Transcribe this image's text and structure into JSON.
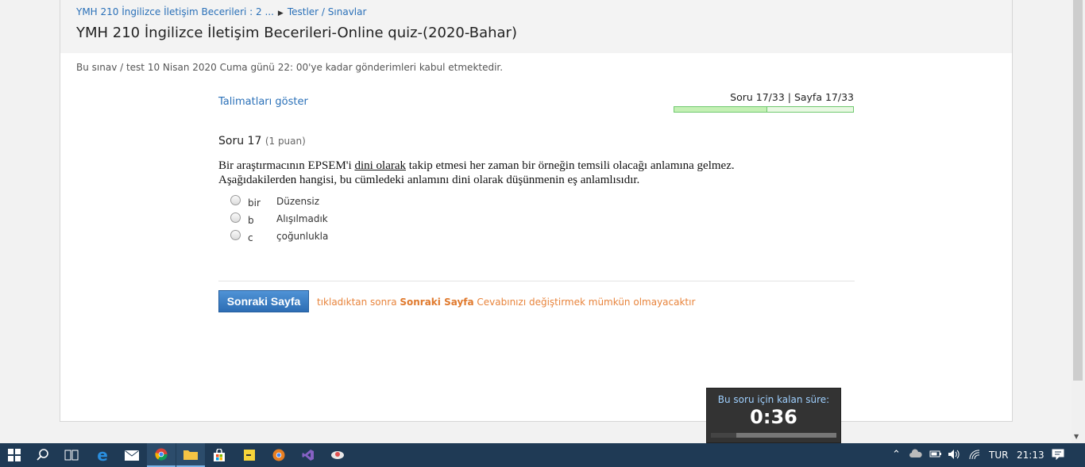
{
  "breadcrumb": {
    "course": "YMH 210 İngilizce İletişim Becerileri : 2 ...",
    "section": "Testler / Sınavlar"
  },
  "page_title": "YMH 210 İngilizce İletişim Becerileri-Online quiz-(2020-Bahar)",
  "notice": "Bu sınav / test 10 Nisan 2020 Cuma günü 22: 00'ye kadar gönderimleri kabul etmektedir.",
  "quiz": {
    "show_instructions": "Talimatları göster",
    "progress_text": "Soru 17/33 | Sayfa 17/33",
    "progress_fraction": 0.52,
    "question_label": "Soru 17",
    "question_points": "(1 puan)",
    "question_text_before": "Bir araştırmacının EPSEM'i ",
    "question_text_underlined": "dini olarak",
    "question_text_after": " takip etmesi her zaman bir örneğin temsili olacağı anlamına gelmez.",
    "question_text_line2": "Aşağıdakilerden hangisi, bu cümledeki anlamını dini olarak düşünmenin eş anlamlısıdır.",
    "options": [
      {
        "letter": "bir",
        "text": "Düzensiz"
      },
      {
        "letter": "b",
        "text": "Alışılmadık"
      },
      {
        "letter": "c",
        "text": "çoğunlukla"
      }
    ],
    "next_button": "Sonraki Sayfa",
    "next_note_before": "tıkladıktan sonra ",
    "next_note_bold": "Sonraki Sayfa",
    "next_note_after": " Cevabınızı değiştirmek mümkün olmayacaktır"
  },
  "timer": {
    "label": "Bu soru için kalan süre:",
    "value": "0:36",
    "remaining_fraction": 0.2
  },
  "taskbar": {
    "icons": [
      "windows-start-icon",
      "search-icon",
      "task-view-icon",
      "edge-icon",
      "mail-icon",
      "chrome-icon",
      "file-explorer-icon",
      "store-icon",
      "sticky-notes-icon",
      "chrome-canary-icon",
      "visual-studio-icon",
      "app-icon"
    ],
    "language": "TUR",
    "time": "21:13"
  },
  "colors": {
    "link": "#2a70b8",
    "button": "#2d6db4",
    "warning": "#e8843c",
    "taskbar": "#1f3a55",
    "progress": "#6fc96f"
  }
}
